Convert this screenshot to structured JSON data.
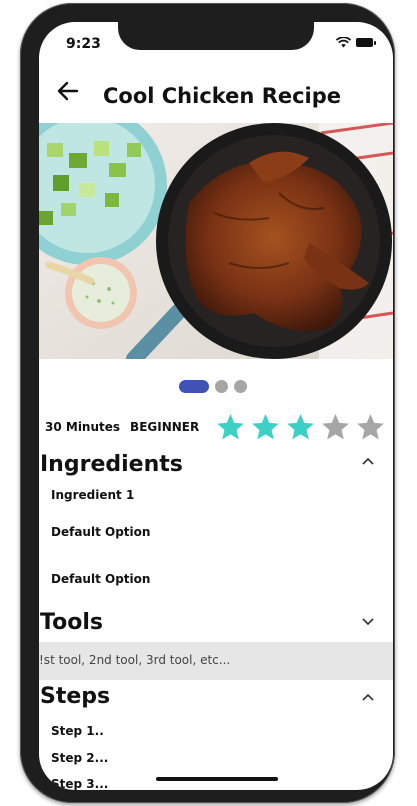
{
  "status": {
    "time": "9:23"
  },
  "header": {
    "title": "Cool Chicken Recipe"
  },
  "carousel": {
    "total": 3,
    "active_index": 0
  },
  "meta": {
    "duration": "30 Minutes",
    "level": "BEGINNER",
    "rating": 3,
    "rating_max": 5
  },
  "colors": {
    "star_filled": "#3dd1c6",
    "star_empty": "#a6a6a6",
    "dot_active": "#3f52b5"
  },
  "ingredients": {
    "title": "Ingredients",
    "items": [
      "Ingredient 1",
      "Default Option",
      "Default Option"
    ]
  },
  "tools": {
    "title": "Tools",
    "text": "!st tool, 2nd tool, 3rd tool, etc..."
  },
  "steps": {
    "title": "Steps",
    "items": [
      "Step 1..",
      "Step 2...",
      "Step 3..."
    ]
  },
  "icons": {
    "back": "arrow-left-icon",
    "wifi": "wifi-icon",
    "battery": "battery-icon",
    "expand": "chevron-up-icon",
    "collapse": "chevron-down-icon",
    "star": "star-icon"
  }
}
